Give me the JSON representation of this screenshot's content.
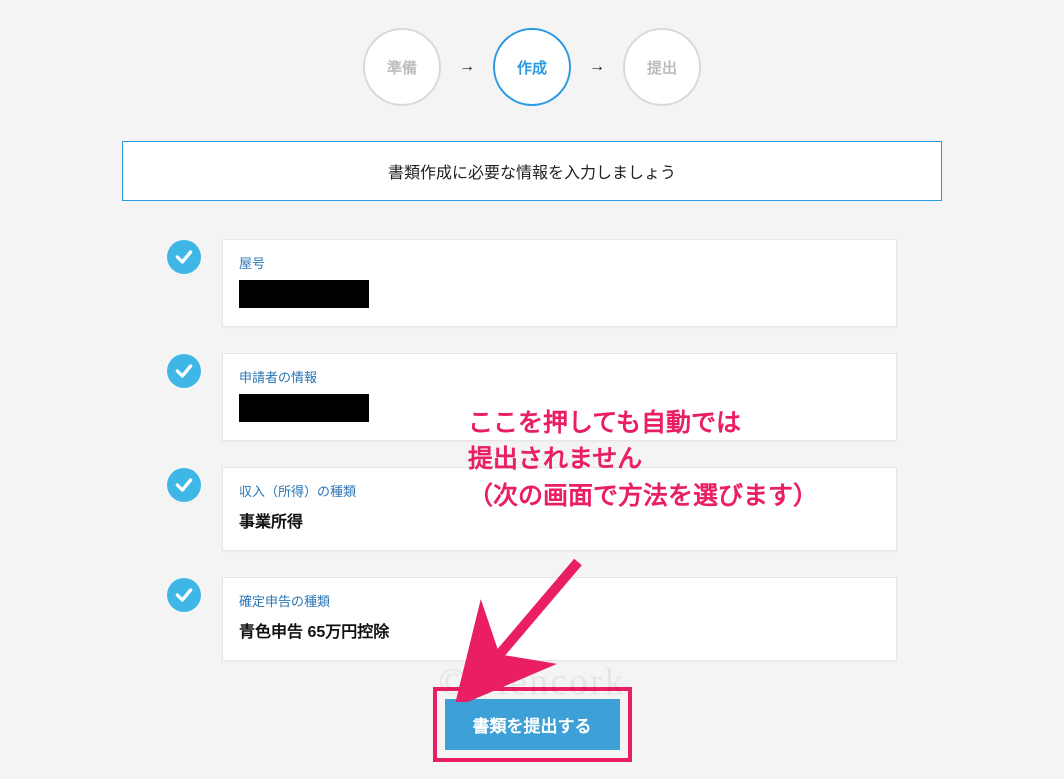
{
  "steps": {
    "items": [
      {
        "label": "準備",
        "state": "inactive"
      },
      {
        "label": "作成",
        "state": "active"
      },
      {
        "label": "提出",
        "state": "inactive"
      }
    ]
  },
  "banner": {
    "text": "書類作成に必要な情報を入力しましょう"
  },
  "cards": [
    {
      "label": "屋号",
      "value": "",
      "redacted": true
    },
    {
      "label": "申請者の情報",
      "value": "",
      "redacted": true
    },
    {
      "label": "収入（所得）の種類",
      "value": "事業所得",
      "redacted": false
    },
    {
      "label": "確定申告の種類",
      "value": "青色申告 65万円控除",
      "redacted": false
    }
  ],
  "submit": {
    "label": "書類を提出する"
  },
  "annotation": {
    "text": "ここを押しても自動では\n提出されません\n（次の画面で方法を選びます）"
  },
  "watermark": "© Hencork",
  "colors": {
    "accent_blue": "#2a9be2",
    "check_blue": "#3fb7e6",
    "button_blue": "#3da0d6",
    "annotation_pink": "#e91e63",
    "label_blue": "#2a76b6"
  }
}
